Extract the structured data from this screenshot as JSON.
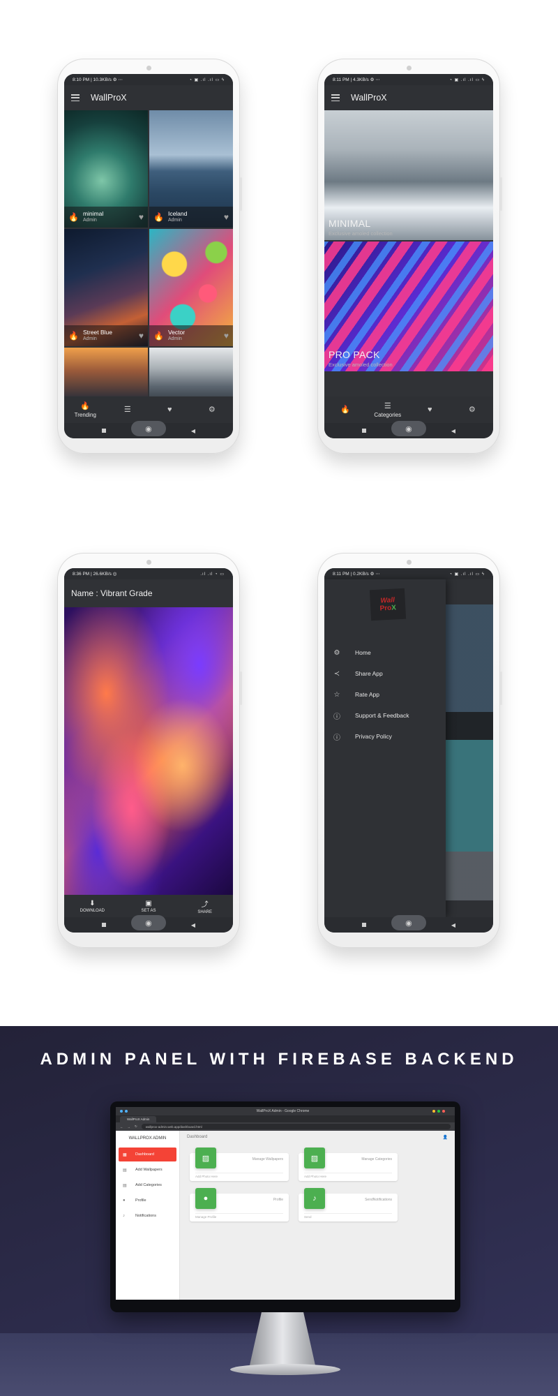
{
  "phone1": {
    "status_left": "8:10 PM | 10.3KB/s ⚙ ⋯",
    "status_right": "◔ ▣ .ıl .ıl ▭ ϟ",
    "app_title": "WallProX",
    "tiles": [
      {
        "name": "minimal",
        "author": "Admin"
      },
      {
        "name": "Iceland",
        "author": "Admin"
      },
      {
        "name": "Street Blue",
        "author": "Admin"
      },
      {
        "name": "Vector",
        "author": "Admin"
      }
    ],
    "nav": [
      {
        "icon": "fire-icon",
        "label": "Trending"
      },
      {
        "icon": "list-icon",
        "label": ""
      },
      {
        "icon": "heart-icon",
        "label": ""
      },
      {
        "icon": "gear-icon",
        "label": ""
      }
    ]
  },
  "phone2": {
    "status_left": "8:11 PM | 4.3KB/s ⚙ ⋯",
    "status_right": "◔ ▣ .ıl .ıl ▭ ϟ",
    "app_title": "WallProX",
    "categories": [
      {
        "title": "MINIMAL",
        "subtitle": "Exclusive amoled collection"
      },
      {
        "title": "PRO PACK",
        "subtitle": "Exclusive amoled collection"
      }
    ],
    "nav": [
      {
        "icon": "fire-icon",
        "label": ""
      },
      {
        "icon": "list-icon",
        "label": "Categories"
      },
      {
        "icon": "heart-icon",
        "label": ""
      },
      {
        "icon": "gear-icon",
        "label": ""
      }
    ]
  },
  "phone3": {
    "status_left": "8:36 PM | 26.6KB/s ◎",
    "status_right": ".ıl .ıl ◔ ▭",
    "title": "Name : Vibrant Grade",
    "actions": [
      {
        "icon": "download-icon",
        "label": "DOWNLOAD"
      },
      {
        "icon": "set-as-icon",
        "label": "SET AS"
      },
      {
        "icon": "share-icon",
        "label": "SHARE"
      }
    ]
  },
  "phone4": {
    "status_left": "8:11 PM | 0.2KB/s ⚙ ⋯",
    "status_right": "◔ ▣ .ıl .ıl ▭ ϟ",
    "logo_line1": "Wall",
    "logo_line2a": "Pro",
    "logo_line2b": "X",
    "menu": [
      {
        "icon": "gear-icon",
        "label": "Home"
      },
      {
        "icon": "share-icon",
        "label": "Share App"
      },
      {
        "icon": "star-icon",
        "label": "Rate App"
      },
      {
        "icon": "help-icon",
        "label": "Support & Feedback"
      },
      {
        "icon": "help-icon",
        "label": "Privacy Policy"
      }
    ]
  },
  "admin": {
    "headline": "ADMIN PANEL WITH FIREBASE BACKEND",
    "window_title": "WallProX Admin - Google Chrome",
    "tab_label": "WallProX Admin",
    "url": "wallprox-admin.web.app/dashboard.html",
    "brand": "WALLPROX ADMIN",
    "topbar_title": "Dashboard",
    "sidebar": [
      {
        "icon": "dashboard-icon",
        "label": "Dashboard",
        "active": true
      },
      {
        "icon": "image-icon",
        "label": "Add Wallpapers"
      },
      {
        "icon": "image-icon",
        "label": "Add Categories"
      },
      {
        "icon": "user-icon",
        "label": "Profile"
      },
      {
        "icon": "bell-icon",
        "label": "Notifications"
      }
    ],
    "cards": [
      {
        "icon": "image-icon",
        "title": "Manage Wallpapers",
        "footer": "Add Photo Here"
      },
      {
        "icon": "image-icon",
        "title": "Manage Categories",
        "footer": "Add Photo Here"
      },
      {
        "icon": "user-icon",
        "title": "Profile",
        "footer": "Manage Profile"
      },
      {
        "icon": "bell-icon",
        "title": "SendNotifications",
        "footer": "Send"
      }
    ],
    "colors": {
      "accent": "#f44336",
      "card_icon": "#4caf50",
      "banner_bg": "#2d2c4c"
    }
  }
}
